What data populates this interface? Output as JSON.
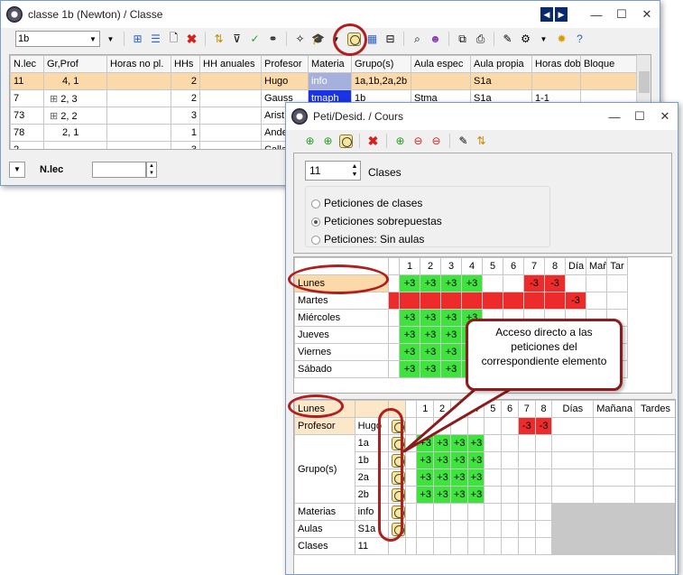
{
  "main_window": {
    "title": "classe 1b (Newton) / Classe",
    "selector_value": "1b",
    "columns": [
      "N.lec",
      "Gr,Prof",
      "Horas no pl.",
      "HHs",
      "HH anuales",
      "Profesor",
      "Materia",
      "Grupo(s)",
      "Aula espec",
      "Aula propia",
      "Horas dobl.",
      "Bloque"
    ],
    "rows": [
      {
        "nlec": "11",
        "grprof": "4, 1",
        "horas": "",
        "hhs": "2",
        "hha": "",
        "prof": "Hugo",
        "mat": "info",
        "grupo": "1a,1b,2a,2b",
        "aulae": "",
        "aulap": "S1a",
        "dobl": "",
        "bloque": ""
      },
      {
        "nlec": "7",
        "grprof": "2, 3",
        "horas": "",
        "hhs": "2",
        "hha": "",
        "prof": "Gauss",
        "mat": "tmaph",
        "grupo": "1b",
        "aulae": "Stma",
        "aulap": "S1a",
        "dobl": "1-1",
        "bloque": ""
      },
      {
        "nlec": "73",
        "grprof": "2, 2",
        "horas": "",
        "hhs": "3",
        "hha": "",
        "prof": "Arist",
        "mat": "",
        "grupo": "",
        "aulae": "",
        "aulap": "",
        "dobl": "",
        "bloque": ""
      },
      {
        "nlec": "78",
        "grprof": "2, 1",
        "horas": "",
        "hhs": "1",
        "hha": "",
        "prof": "Ande",
        "mat": "",
        "grupo": "",
        "aulae": "",
        "aulap": "",
        "dobl": "",
        "bloque": ""
      },
      {
        "nlec": "2",
        "grprof": "",
        "horas": "",
        "hhs": "3",
        "hha": "",
        "prof": "Callas",
        "mat": "",
        "grupo": "",
        "aulae": "",
        "aulap": "",
        "dobl": "",
        "bloque": ""
      }
    ],
    "footer_label": "N.lec"
  },
  "peti_window": {
    "title": "Peti/Desid. / Cours",
    "lesson_value": "11",
    "lesson_label": "Clases",
    "radio_options": [
      "Peticiones de clases",
      "Peticiones sobrepuestas",
      "Peticiones: Sin aulas"
    ],
    "grid1": {
      "headers": [
        "1",
        "2",
        "3",
        "4",
        "5",
        "6",
        "7",
        "8",
        "Día",
        "Mañ",
        "Tar"
      ],
      "rows": [
        {
          "day": "Lunes",
          "cells": [
            "+3",
            "+3",
            "+3",
            "+3",
            "",
            "",
            "-3",
            "-3",
            "",
            "",
            ""
          ]
        },
        {
          "day": "Martes",
          "cells": [
            "",
            "",
            "",
            "",
            "",
            "",
            "",
            "",
            "-3",
            "",
            ""
          ]
        },
        {
          "day": "Miércoles",
          "cells": [
            "+3",
            "+3",
            "+3",
            "+3",
            "",
            "",
            "",
            "",
            "",
            "",
            ""
          ]
        },
        {
          "day": "Jueves",
          "cells": [
            "+3",
            "+3",
            "+3",
            "+3",
            "",
            "",
            "",
            "",
            "",
            "",
            ""
          ]
        },
        {
          "day": "Viernes",
          "cells": [
            "+3",
            "+3",
            "+3",
            "+3",
            "",
            "",
            "",
            "",
            "",
            "",
            ""
          ]
        },
        {
          "day": "Sábado",
          "cells": [
            "+3",
            "+3",
            "+3",
            "+3",
            "",
            "",
            "",
            "",
            "",
            "",
            ""
          ]
        }
      ]
    },
    "grid2": {
      "day": "Lunes",
      "headers": [
        "1",
        "2",
        "3",
        "4",
        "5",
        "6",
        "7",
        "8",
        "Días",
        "Mañana",
        "Tardes"
      ],
      "profesor_label": "Profesor",
      "profesor_value": "Hugo",
      "grupos_label": "Grupo(s)",
      "grupos": [
        "1a",
        "1b",
        "2a",
        "2b"
      ],
      "materias_label": "Materias",
      "materias_value": "info",
      "aulas_label": "Aulas",
      "aulas_value": "S1a",
      "clases_label": "Clases",
      "clases_value": "11",
      "profesor_cells": [
        "",
        "",
        "",
        "",
        "",
        "",
        "-3",
        "-3"
      ],
      "grupo_cells": [
        "+3",
        "+3",
        "+3",
        "+3",
        "",
        "",
        "",
        ""
      ]
    }
  },
  "callout": {
    "text": "Acceso directo a las peticiones del correspondiente elemento"
  }
}
